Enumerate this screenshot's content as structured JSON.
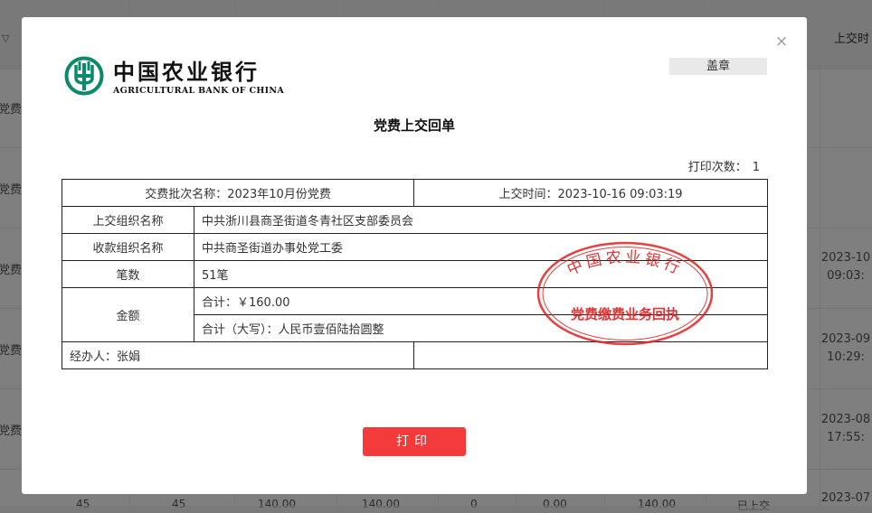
{
  "background": {
    "header_right": "上交时",
    "row_texts": [
      "党费",
      "党费",
      "党费",
      "党费",
      "党费"
    ],
    "right_cells": [
      {
        "line1": "2023-10",
        "line2": "09:03:"
      },
      {
        "line1": "2023-09",
        "line2": "10:29:"
      },
      {
        "line1": "2023-08",
        "line2": "17:55:"
      },
      {
        "line1": "2023-07",
        "line2": ""
      }
    ],
    "bottom_row": [
      "45",
      "45",
      "140.00",
      "140.00",
      "0",
      "0.00",
      "140.00",
      "已上交"
    ]
  },
  "modal": {
    "close_glyph": "×",
    "logo": {
      "cn": "中国农业银行",
      "en": "AGRICULTURAL BANK OF CHINA",
      "icon": "abc-logo-icon",
      "color": "#0a8a6b"
    },
    "seal_button": "盖章",
    "title": "党费上交回单",
    "print_count_label": "打印次数：",
    "print_count_value": "1",
    "table": {
      "batch": "交费批次名称：2023年10月份党费",
      "time": "上交时间：2023-10-16 09:03:19",
      "submit_org_label": "上交组织名称",
      "submit_org_value": "中共浙川县商圣街道冬青社区支部委员会",
      "receive_org_label": "收款组织名称",
      "receive_org_value": "中共商圣街道办事处党工委",
      "count_label": "笔数",
      "count_value": "51笔",
      "amount_label": "金额",
      "total": "合计：￥160.00",
      "total_caps": "合计（大写）：人民币壹佰陆拾圆整",
      "handler": "经办人：张娟",
      "handler_extra": ""
    },
    "stamp": {
      "top_text": "中国农业银行",
      "bottom_text": "党费缴费业务回执",
      "color": "#e02020"
    },
    "print_button": "打印"
  }
}
